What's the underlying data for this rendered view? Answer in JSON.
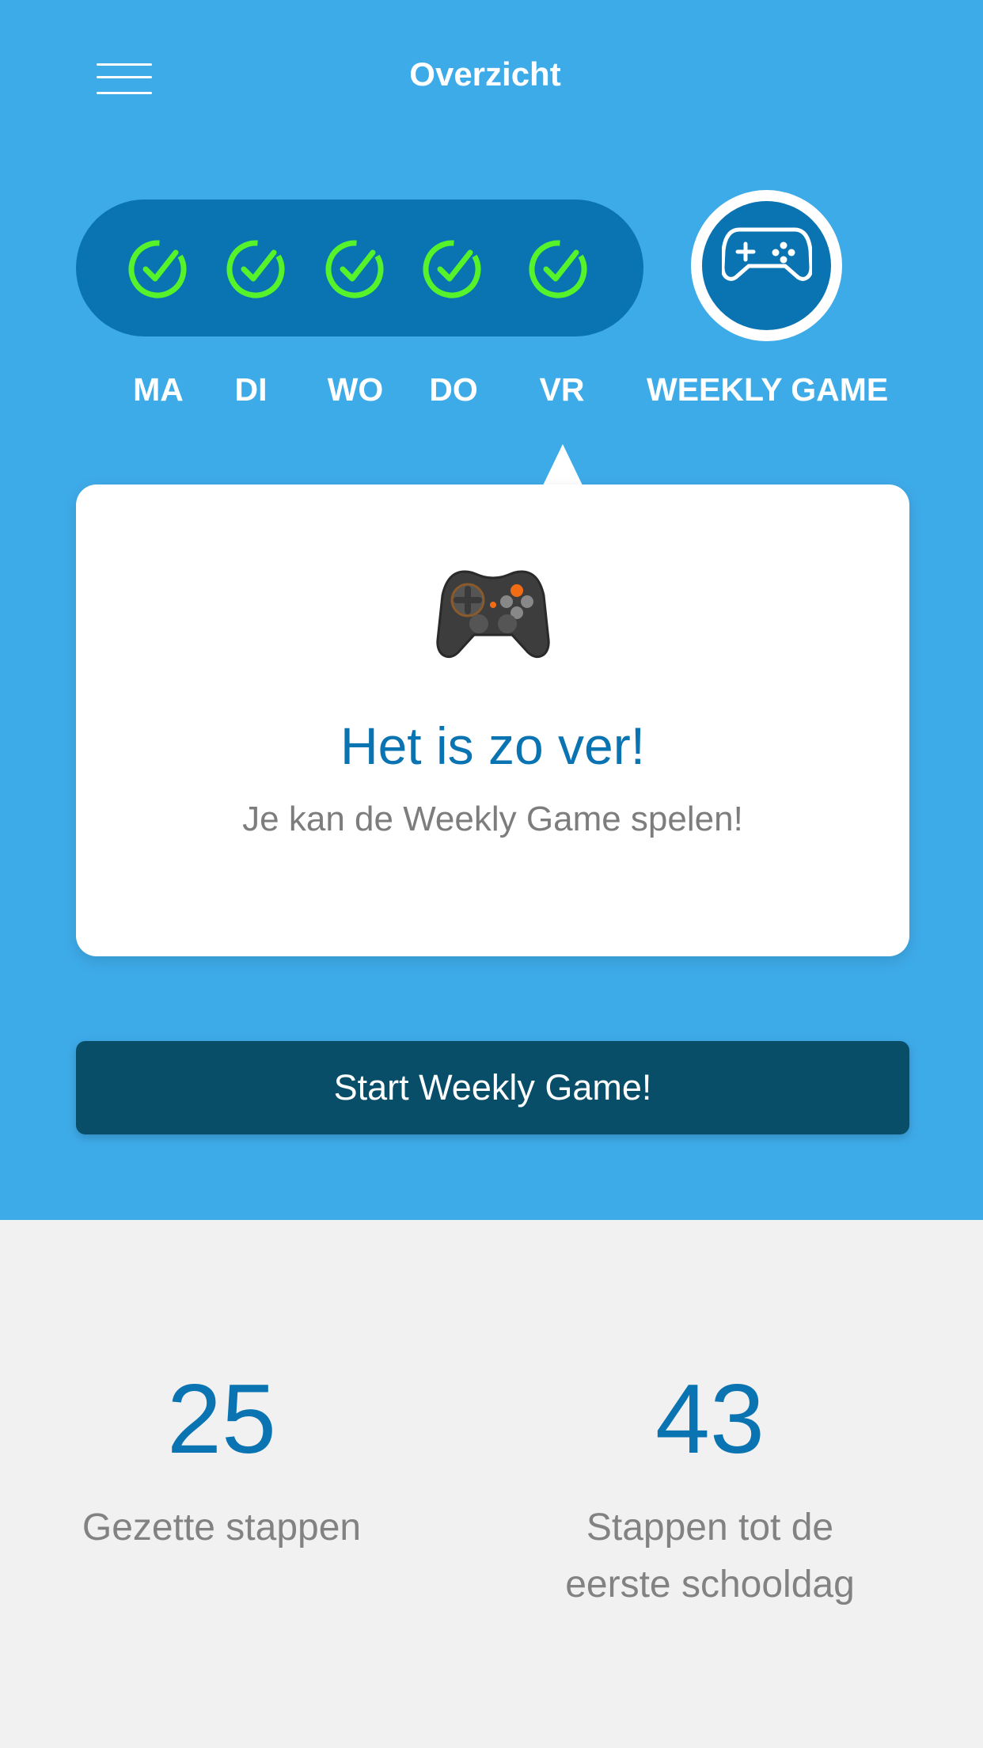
{
  "header": {
    "title": "Overzicht",
    "menu_icon": "hamburger-menu-icon"
  },
  "week": {
    "days": [
      {
        "label": "MA",
        "completed": true
      },
      {
        "label": "DI",
        "completed": true
      },
      {
        "label": "WO",
        "completed": true
      },
      {
        "label": "DO",
        "completed": true
      },
      {
        "label": "VR",
        "completed": true
      }
    ],
    "weekly_game_label": "WEEKLY GAME",
    "weekly_game_icon": "gamepad-icon",
    "check_color": "#56f32b"
  },
  "card": {
    "emoji": "🎮",
    "title": "Het is zo ver!",
    "subtitle": "Je kan de Weekly Game spelen!"
  },
  "start_button": {
    "label": "Start Weekly Game!"
  },
  "stats": [
    {
      "value": "25",
      "label": "Gezette stappen"
    },
    {
      "value": "43",
      "label": "Stappen tot de eerste schooldag"
    }
  ],
  "colors": {
    "top_background": "#3eabe9",
    "pill": "#0a73b1",
    "button": "#084e68",
    "accent_text": "#0a73b1",
    "bottom_background": "#f1f1f1"
  }
}
